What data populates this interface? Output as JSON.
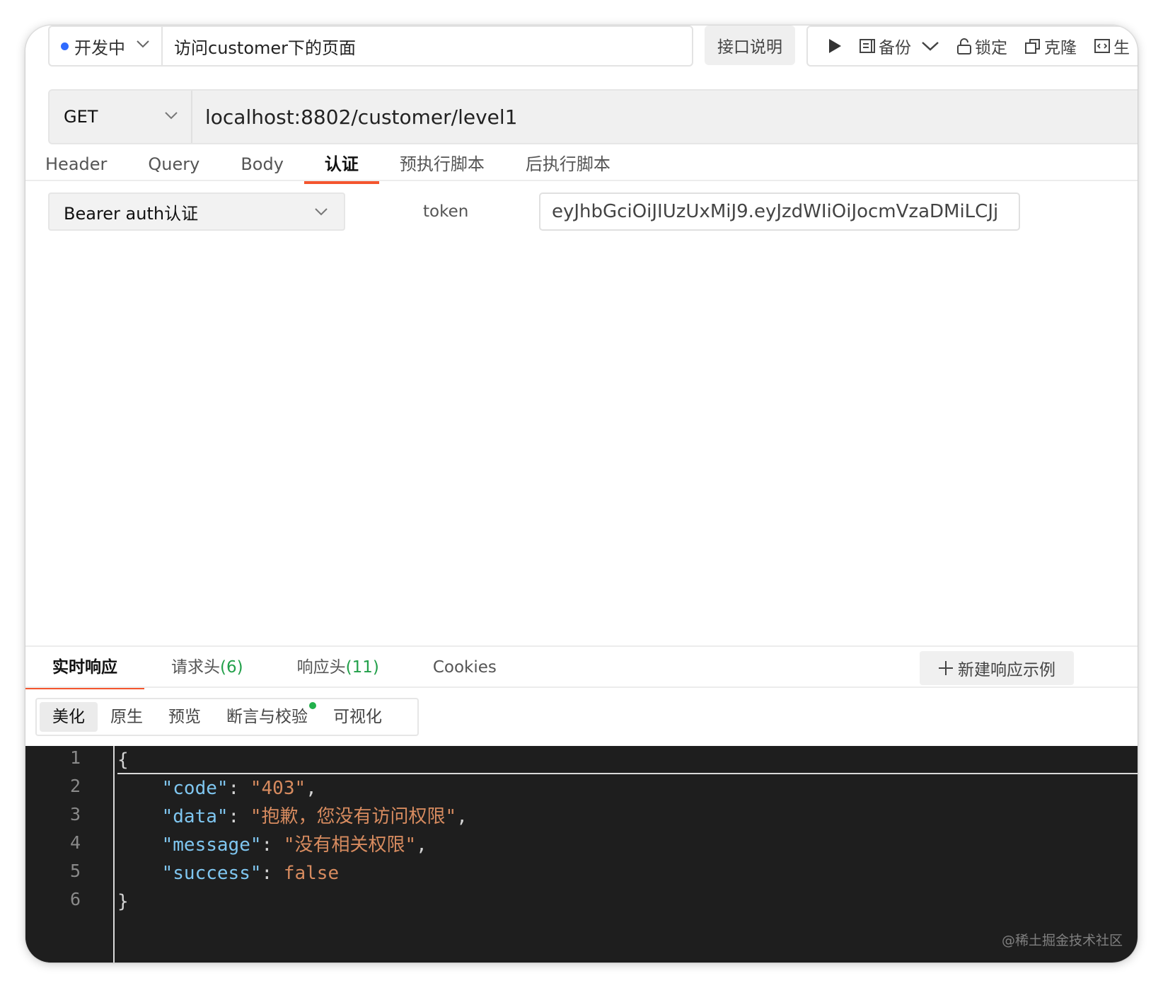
{
  "top_bar": {
    "status_label": "开发中",
    "status_color": "#2f6bff",
    "api_name": "访问customer下的页面",
    "doc_button": "接口说明",
    "toolbar": {
      "run_icon": "play-icon",
      "backup_label": "备份",
      "lock_label": "锁定",
      "clone_label": "克隆",
      "generate_label": "生"
    }
  },
  "request": {
    "method": "GET",
    "url": "localhost:8802/customer/level1",
    "tabs": [
      {
        "label": "Header"
      },
      {
        "label": "Query"
      },
      {
        "label": "Body"
      },
      {
        "label": "认证",
        "active": true
      },
      {
        "label": "预执行脚本"
      },
      {
        "label": "后执行脚本"
      }
    ]
  },
  "auth": {
    "type": "Bearer auth认证",
    "token_label": "token",
    "token_value": "eyJhbGciOiJIUzUxMiJ9.eyJzdWIiOiJocmVzaDMiLCJj"
  },
  "response": {
    "tabs": [
      {
        "label": "实时响应",
        "count": ""
      },
      {
        "label": "请求头",
        "count": "(6)"
      },
      {
        "label": "响应头",
        "count": "(11)"
      },
      {
        "label": "Cookies",
        "count": ""
      }
    ],
    "new_example_label": "新建响应示例",
    "view_modes": [
      "美化",
      "原生",
      "预览",
      "断言与校验",
      "可视化"
    ],
    "line_numbers": [
      "1",
      "2",
      "3",
      "4",
      "5",
      "6"
    ],
    "body": {
      "code": "403",
      "data": "抱歉，您没有访问权限",
      "message": "没有相关权限",
      "success": "false"
    }
  },
  "accent_color": "#f4552e",
  "watermark": "@稀土掘金技术社区"
}
